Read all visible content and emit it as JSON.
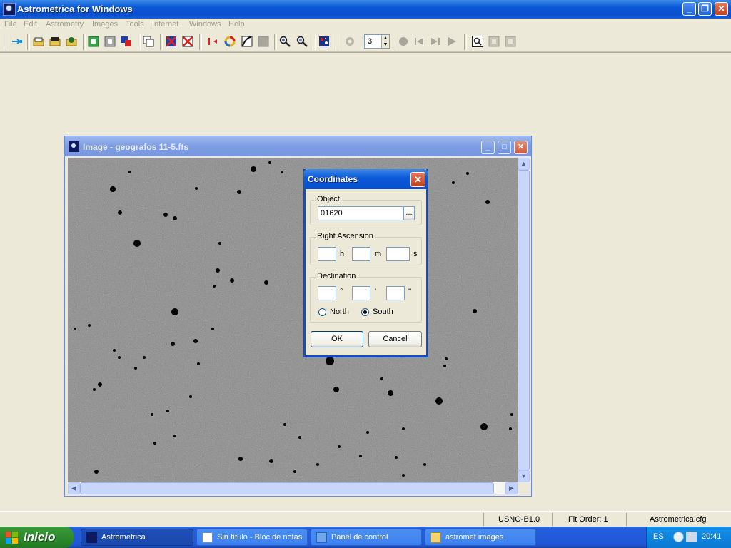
{
  "app": {
    "title": "Astrometrica for Windows",
    "caption_buttons": {
      "minimize": "_",
      "restore": "❐",
      "close": "✕"
    }
  },
  "menu": [
    "File",
    "Edit",
    "Astrometry",
    "Images",
    "Tools",
    "Internet",
    "Windows",
    "Help"
  ],
  "toolbar": {
    "icons": [
      "connect-icon",
      "open-folder-icon",
      "open-images-icon",
      "load-images-icon",
      "add-image-icon",
      "blank-image-icon",
      "blink-icon",
      "properties-icon",
      "delete-red-icon",
      "close-red-icon",
      "flip-icon",
      "color-wheel-icon",
      "curve-icon",
      "gray-square-icon",
      "zoom-in-icon",
      "zoom-out-icon",
      "star-chart-icon",
      "disabled-gear-icon",
      "record-icon",
      "step-back-icon",
      "step-forward-icon",
      "play-icon",
      "magnifier-icon",
      "gray-box-1-icon",
      "gray-box-2-icon"
    ],
    "spin_value": "3"
  },
  "image_window": {
    "title": "Image - geografos 11-5.fts",
    "caption_buttons": {
      "minimize": "_",
      "maximize": "□",
      "close": "✕"
    }
  },
  "dialog": {
    "title": "Coordinates",
    "close": "✕",
    "object_group": "Object",
    "object_value": "01620",
    "browse_label": "...",
    "ra_group": "Right Ascension",
    "ra_units": [
      "h",
      "m",
      "s"
    ],
    "dec_group": "Declination",
    "dec_units": [
      "°",
      "'",
      "''"
    ],
    "north_label": "North",
    "south_label": "South",
    "hemisphere_selected": "South",
    "ok_label": "OK",
    "cancel_label": "Cancel"
  },
  "status": {
    "catalog": "USNO-B1.0",
    "fit_order": "Fit Order: 1",
    "config": "Astrometrica.cfg"
  },
  "taskbar": {
    "start": "Inicio",
    "tasks": [
      "Astrometrica",
      "Sin título - Bloc de notas",
      "Panel de control",
      "astromet images"
    ],
    "language": "ES",
    "clock": "20:41"
  }
}
